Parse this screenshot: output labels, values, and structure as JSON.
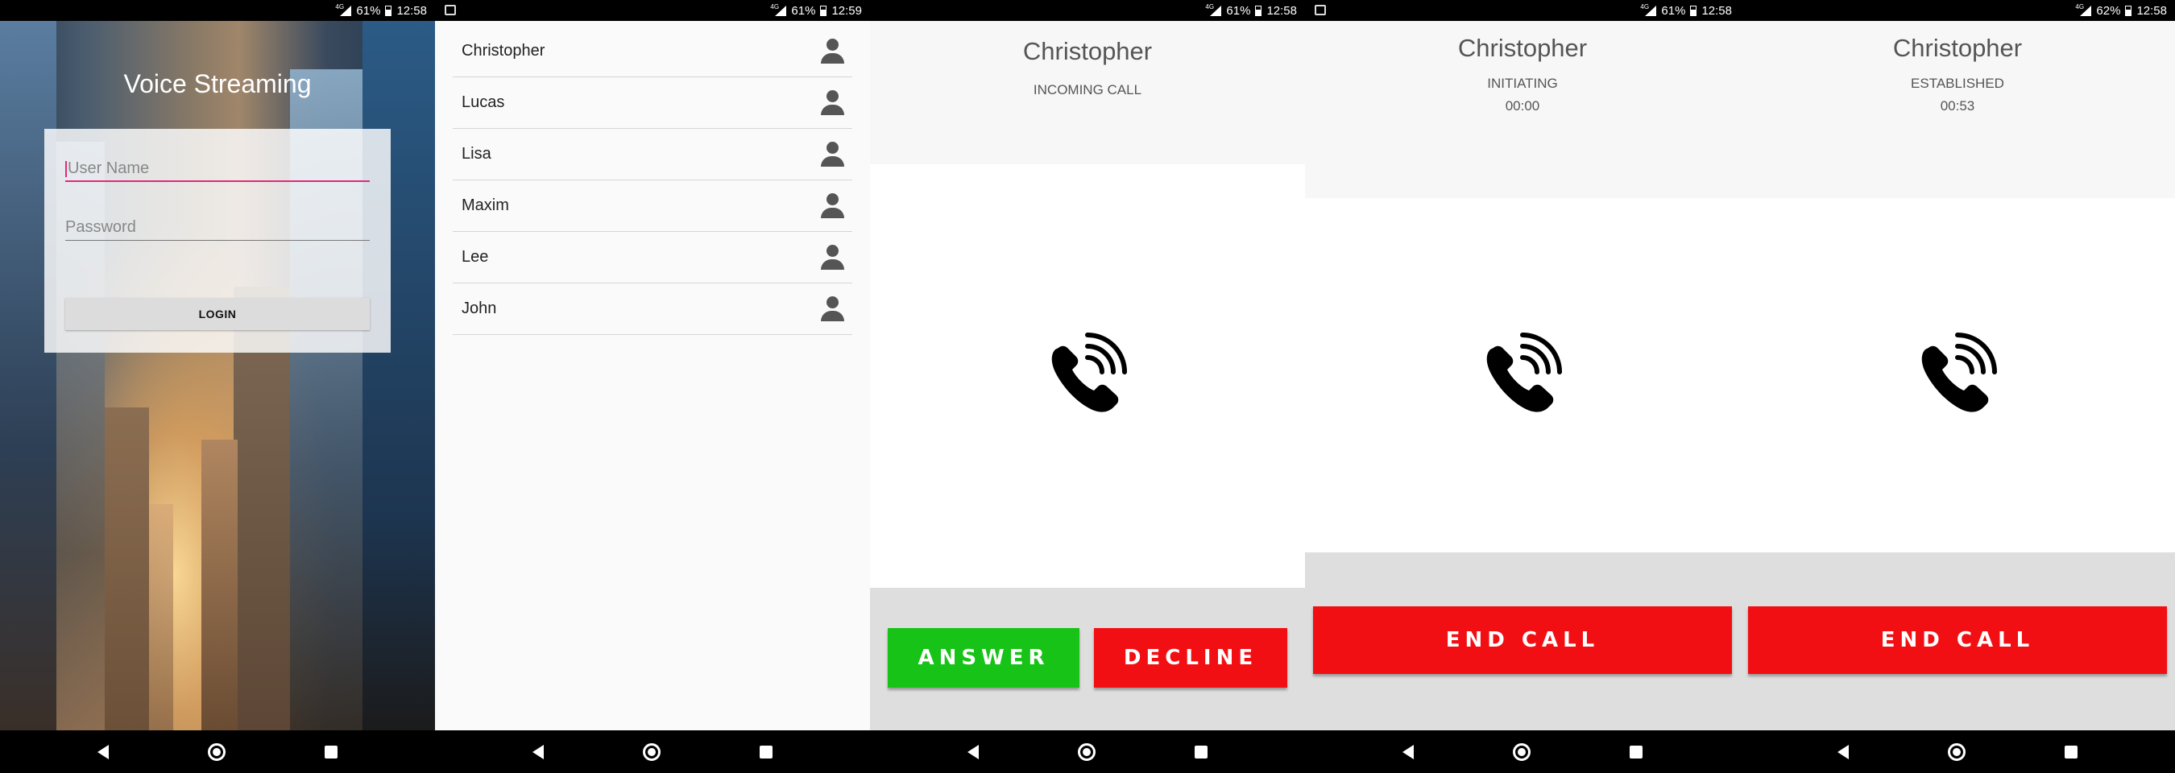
{
  "status": {
    "s1": {
      "battery": "61%",
      "time": "12:58"
    },
    "s2": {
      "battery": "61%",
      "time": "12:59"
    },
    "s3": {
      "battery": "61%",
      "time": "12:58"
    },
    "s4": {
      "battery": "61%",
      "time": "12:58"
    },
    "s5": {
      "battery": "62%",
      "time": "12:58"
    },
    "network": "4G"
  },
  "login": {
    "title": "Voice Streaming",
    "username_placeholder": "User Name",
    "password_placeholder": "Password",
    "login_label": "LOGIN",
    "accent_color": "#e0297a"
  },
  "contacts": [
    {
      "name": "Christopher"
    },
    {
      "name": "Lucas"
    },
    {
      "name": "Lisa"
    },
    {
      "name": "Maxim"
    },
    {
      "name": "Lee"
    },
    {
      "name": "John"
    }
  ],
  "incoming": {
    "caller": "Christopher",
    "status": "INCOMING CALL",
    "answer_label": "ANSWER",
    "decline_label": "DECLINE",
    "answer_color": "#17c317",
    "decline_color": "#f20f13"
  },
  "initiating": {
    "caller": "Christopher",
    "status": "INITIATING",
    "timer": "00:00",
    "end_label": "END CALL"
  },
  "established": {
    "caller": "Christopher",
    "status": "ESTABLISHED",
    "timer": "00:53",
    "end_label": "END CALL"
  },
  "icons": [
    "person-icon",
    "phone-ringing-icon",
    "back-icon",
    "home-icon",
    "recents-icon"
  ]
}
